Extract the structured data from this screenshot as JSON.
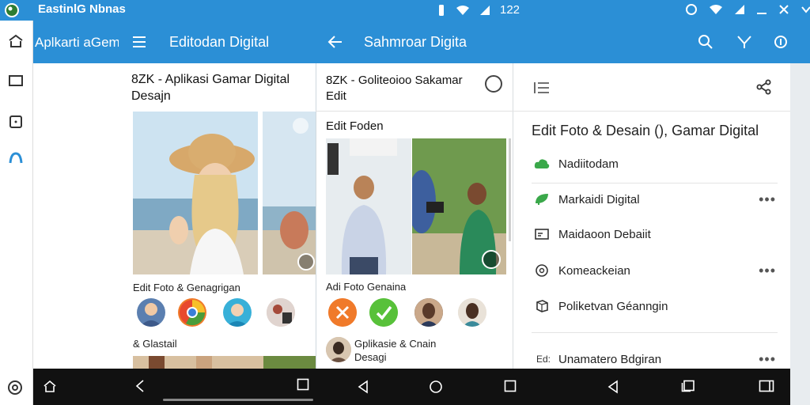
{
  "status_bar": {
    "left_title": "EastinlG Nbnas",
    "time": "122"
  },
  "rail": {
    "title": "Aplkarti aGem"
  },
  "app1": {
    "header_title": "Editodan Digital",
    "card_title": "8ZK - Aplikasi Gamar Digital Desajn",
    "section_label": "Edit Foto & Genagrigan",
    "bottom_label": "& Glastail"
  },
  "app2": {
    "header_title": "Sahmroar Digita",
    "card_title": "8ZK - Goliteoioo Sakamar Edit",
    "section_title": "Edit Foden",
    "section_label": "Adi Foto Genaina",
    "bottom_label_1": "Gplikasie & Cnain",
    "bottom_label_2": "Desagi"
  },
  "drawer": {
    "title": "Edit Foto & Desain (), Gamar Digital",
    "items": [
      {
        "label": "Nadiitodam",
        "icon": "cloud-icon",
        "more": ""
      },
      {
        "label": "Markaidi Digital",
        "icon": "leaf-icon",
        "more": "•••"
      },
      {
        "label": "Maidaoon Debaiit",
        "icon": "card-icon",
        "more": ""
      },
      {
        "label": "Komeackeian",
        "icon": "circle-icon",
        "more": "•••"
      },
      {
        "label": "Poliketvan Géanngin",
        "icon": "cube-icon",
        "more": ""
      }
    ],
    "footer_label": "Unamatero Bdgiran",
    "footer_prefix": "Ed:",
    "footer_more": "•••"
  },
  "colors": {
    "header_blue": "#2b8fd6",
    "nav_bar": "#111111",
    "accent_orange": "#f07a2a",
    "accent_green": "#58c13a"
  }
}
